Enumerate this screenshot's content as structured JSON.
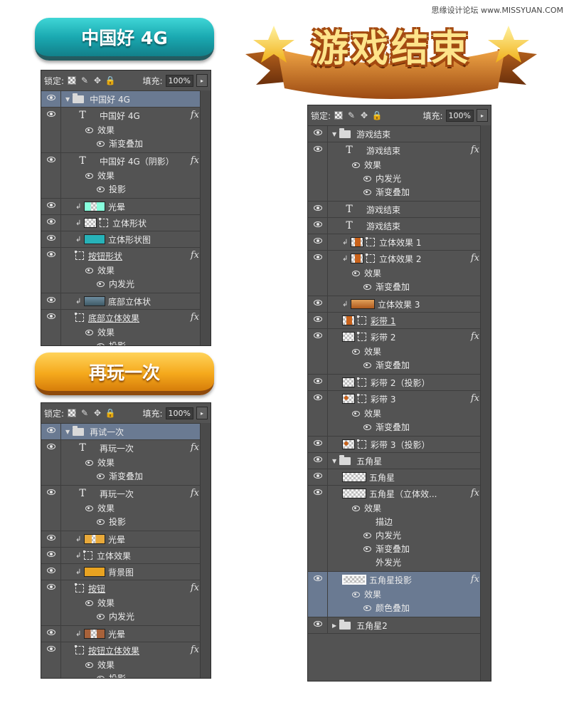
{
  "watermark": "思缘设计论坛 www.MISSYUAN.COM",
  "buttons": {
    "teal": "中国好 4G",
    "orange": "再玩一次",
    "ribbon": "游戏结束"
  },
  "toolbar": {
    "lock_label": "锁定:",
    "fill_label": "填充:",
    "fill_value": "100%"
  },
  "colors": {
    "panel_bg": "#535353",
    "selected_row": "#6a7a92",
    "teal": "#1aa9b1",
    "orange": "#f5a91c"
  },
  "panel1": {
    "rows": [
      {
        "type": "group",
        "label": "中国好 4G",
        "sel": true,
        "indent": 0
      },
      {
        "type": "text",
        "label": "中国好 4G",
        "fx": true,
        "subs": [
          {
            "label": "效果",
            "eye": true,
            "level": 1
          },
          {
            "label": "渐变叠加",
            "eye": true,
            "level": 2
          }
        ]
      },
      {
        "type": "text",
        "label": "中国好 4G（阴影）",
        "fx": true,
        "subs": [
          {
            "label": "效果",
            "eye": true,
            "level": 1
          },
          {
            "label": "投影",
            "eye": true,
            "level": 2
          }
        ]
      },
      {
        "type": "layer",
        "label": "光晕",
        "clip": true,
        "thumb": "teal-chk",
        "wide": true
      },
      {
        "type": "layer",
        "label": "立体形状",
        "clip": true,
        "mask": true,
        "thumb": ""
      },
      {
        "type": "layer",
        "label": "立体形状图",
        "clip": true,
        "thumb": "teal",
        "wide": true
      },
      {
        "type": "layer",
        "label": "按钮形状",
        "mask": true,
        "underline": true,
        "fx": true,
        "subs": [
          {
            "label": "效果",
            "eye": true,
            "level": 1
          },
          {
            "label": "内发光",
            "eye": true,
            "level": 2
          }
        ]
      },
      {
        "type": "layer",
        "label": "底部立体状",
        "clip": true,
        "thumb": "gray-blue",
        "wide": true
      },
      {
        "type": "layer",
        "label": "底部立体效果",
        "mask": true,
        "underline": true,
        "fx": true,
        "subs": [
          {
            "label": "效果",
            "eye": true,
            "level": 1
          },
          {
            "label": "投影",
            "eye": true,
            "level": 2
          }
        ]
      }
    ]
  },
  "panel2": {
    "rows": [
      {
        "type": "group",
        "label": "再试一次",
        "sel": true
      },
      {
        "type": "text",
        "label": "再玩一次",
        "fx": true,
        "subs": [
          {
            "label": "效果",
            "eye": true,
            "level": 1
          },
          {
            "label": "渐变叠加",
            "eye": true,
            "level": 2
          }
        ]
      },
      {
        "type": "text",
        "label": "再玩一次",
        "fx": true,
        "subs": [
          {
            "label": "效果",
            "eye": true,
            "level": 1
          },
          {
            "label": "投影",
            "eye": true,
            "level": 2
          }
        ]
      },
      {
        "type": "layer",
        "label": "光晕",
        "clip": true,
        "thumb": "orange-chk",
        "wide": true
      },
      {
        "type": "layer",
        "label": "立体效果",
        "clip": true,
        "mask": true
      },
      {
        "type": "layer",
        "label": "背景图",
        "clip": true,
        "thumb": "orange",
        "wide": true
      },
      {
        "type": "layer",
        "label": "按钮",
        "mask": true,
        "underline": true,
        "fx": true,
        "subs": [
          {
            "label": "效果",
            "eye": true,
            "level": 1
          },
          {
            "label": "内发光",
            "eye": true,
            "level": 2
          }
        ]
      },
      {
        "type": "layer",
        "label": "光晕",
        "clip": true,
        "thumb": "brown-chk",
        "wide": true
      },
      {
        "type": "layer",
        "label": "按钮立体效果",
        "mask": true,
        "underline": true,
        "fx": true,
        "subs": [
          {
            "label": "效果",
            "eye": true,
            "level": 1
          },
          {
            "label": "投影",
            "eye": true,
            "level": 2
          }
        ]
      }
    ]
  },
  "panel3": {
    "rows": [
      {
        "type": "group",
        "label": "游戏结束",
        "open": true
      },
      {
        "type": "text",
        "label": "游戏结束",
        "fx": true,
        "subs": [
          {
            "label": "效果",
            "eye": true,
            "level": 1
          },
          {
            "label": "内发光",
            "eye": true,
            "level": 2
          },
          {
            "label": "渐变叠加",
            "eye": true,
            "level": 2
          }
        ]
      },
      {
        "type": "text",
        "label": "游戏结束"
      },
      {
        "type": "text",
        "label": "游戏结束"
      },
      {
        "type": "layer",
        "label": "立体效果 1",
        "clip": true,
        "thumb": "ribbon-t",
        "mask": true
      },
      {
        "type": "layer",
        "label": "立体效果 2",
        "clip": true,
        "thumb": "ribbon-t",
        "mask": true,
        "fx": true,
        "subs": [
          {
            "label": "效果",
            "eye": true,
            "level": 1
          },
          {
            "label": "渐变叠加",
            "eye": true,
            "level": 2
          }
        ]
      },
      {
        "type": "layer",
        "label": "立体效果 3",
        "clip": true,
        "thumb": "ribbon-t2"
      },
      {
        "type": "layer",
        "label": "彩带 1",
        "thumb": "ribbon-t",
        "mask": true,
        "underline": true,
        "noindent": true
      },
      {
        "type": "layer",
        "label": "彩带 2",
        "thumb": "",
        "mask": true,
        "fx": true,
        "noindent": true,
        "subs": [
          {
            "label": "效果",
            "eye": true,
            "level": 1
          },
          {
            "label": "渐变叠加",
            "eye": true,
            "level": 2
          }
        ]
      },
      {
        "type": "layer",
        "label": "彩带 2（投影）",
        "thumb": "",
        "mask": true,
        "noindent": true
      },
      {
        "type": "layer",
        "label": "彩带 3",
        "thumb": "star-t",
        "mask": true,
        "fx": true,
        "noindent": true,
        "subs": [
          {
            "label": "效果",
            "eye": true,
            "level": 1
          },
          {
            "label": "渐变叠加",
            "eye": true,
            "level": 2
          }
        ]
      },
      {
        "type": "layer",
        "label": "彩带 3（投影）",
        "thumb": "star-t",
        "mask": true,
        "noindent": true
      },
      {
        "type": "group",
        "label": "五角星",
        "open": true
      },
      {
        "type": "layer",
        "label": "五角星",
        "thumb": "",
        "noindent": true
      },
      {
        "type": "layer",
        "label": "五角星（立体效...",
        "thumb": "",
        "fx": true,
        "noindent": true,
        "subs": [
          {
            "label": "效果",
            "eye": true,
            "level": 1
          },
          {
            "label": "描边",
            "eye": false,
            "level": 2
          },
          {
            "label": "内发光",
            "eye": true,
            "level": 2
          },
          {
            "label": "渐变叠加",
            "eye": true,
            "level": 2
          },
          {
            "label": "外发光",
            "eye": false,
            "level": 2
          }
        ]
      },
      {
        "type": "layer",
        "label": "五角星投影",
        "thumb": "",
        "sel": true,
        "selthumb": true,
        "fx": true,
        "noindent": true,
        "subs": [
          {
            "label": "效果",
            "eye": true,
            "level": 1
          },
          {
            "label": "颜色叠加",
            "eye": true,
            "level": 2
          }
        ]
      },
      {
        "type": "group",
        "label": "五角星2",
        "open": false
      }
    ]
  }
}
